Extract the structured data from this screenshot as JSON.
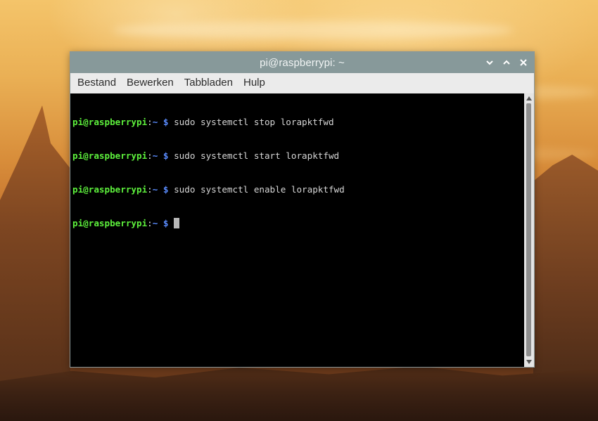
{
  "desktop": {
    "wallpaper": "sunset landscape"
  },
  "window": {
    "title": "pi@raspberrypi: ~",
    "controls": {
      "minimize_icon": "chevron-down-icon",
      "maximize_icon": "chevron-up-icon",
      "close_icon": "close-icon"
    }
  },
  "menu": {
    "items": [
      {
        "label": "Bestand"
      },
      {
        "label": "Bewerken"
      },
      {
        "label": "Tabbladen"
      },
      {
        "label": "Hulp"
      }
    ]
  },
  "terminal": {
    "prompt_user": "pi@raspberrypi",
    "prompt_sep": ":",
    "prompt_path": "~ $",
    "lines": [
      {
        "command": " sudo systemctl stop lorapktfwd"
      },
      {
        "command": " sudo systemctl start lorapktfwd"
      },
      {
        "command": " sudo systemctl enable lorapktfwd"
      },
      {
        "command": " "
      }
    ]
  },
  "colors": {
    "titlebar": "#87999a",
    "prompt_user": "#5df03c",
    "prompt_path": "#5a8cff",
    "terminal_bg": "#000000"
  }
}
